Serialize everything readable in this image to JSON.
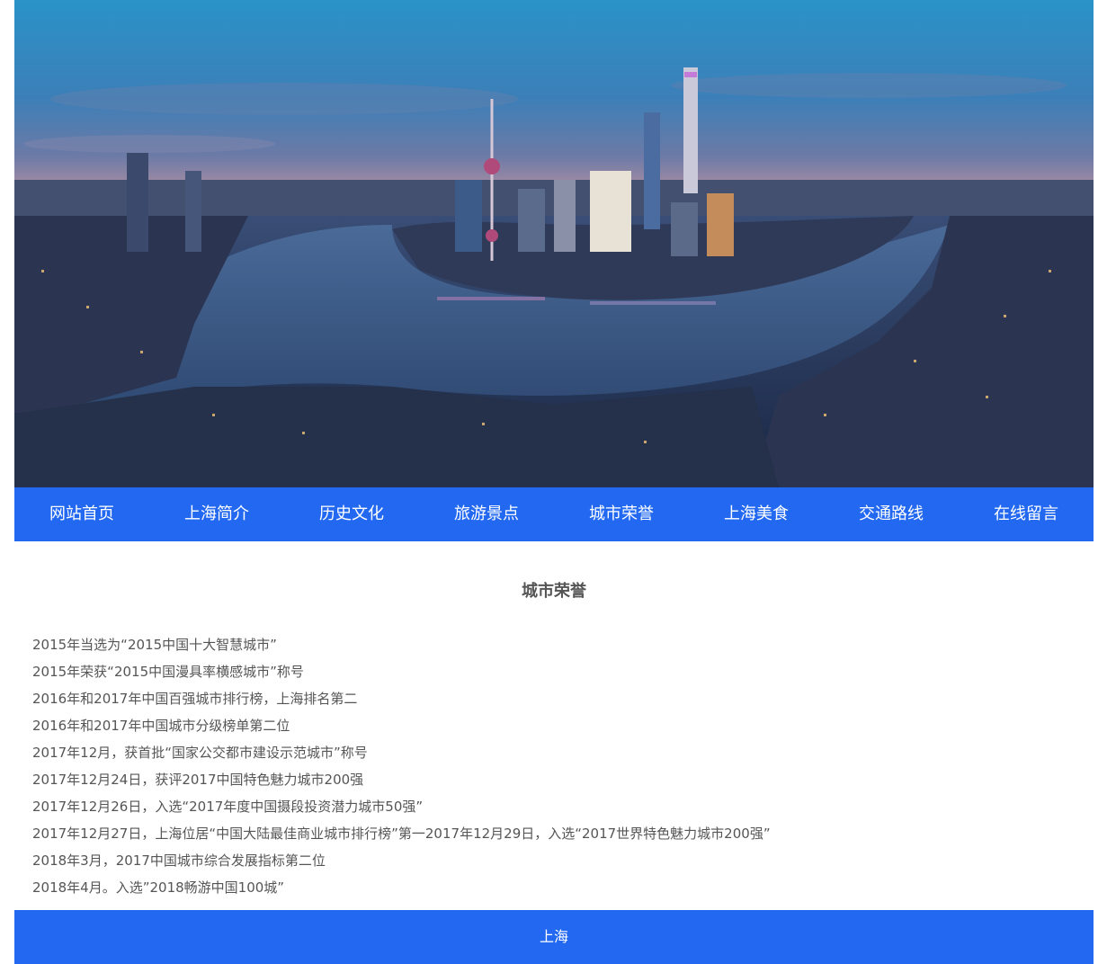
{
  "banner": {
    "image_icon": "city-skyline-photo"
  },
  "nav": {
    "items": [
      {
        "label": "网站首页"
      },
      {
        "label": "上海简介"
      },
      {
        "label": "历史文化"
      },
      {
        "label": "旅游景点"
      },
      {
        "label": "城市荣誉"
      },
      {
        "label": "上海美食"
      },
      {
        "label": "交通路线"
      },
      {
        "label": "在线留言"
      }
    ],
    "bg_color": "#2268f0"
  },
  "content": {
    "title": "城市荣誉",
    "items": [
      "2015年当选为“2015中国十大智慧城市”",
      "2015年荣获“2015中国漫具率横感城市”称号",
      "2016年和2017年中国百强城市排行榜，上海排名第二",
      "2016年和2017年中国城市分级榜单第二位",
      "2017年12月，获首批“国家公交都市建设示范城市”称号",
      "2017年12月24日，获评2017中国特色魅力城市200强",
      "2017年12月26日，入选“2017年度中国摄段投资潜力城市50强”",
      "2017年12月27日，上海位居“中国大陆最佳商业城市排行榜”第一2017年12月29日，入选“2017世界特色魅力城市200强”",
      "2018年3月，2017中国城市综合发展指标第二位",
      "2018年4月。入选”2018畅游中国100城”"
    ]
  },
  "footer": {
    "text": "上海"
  }
}
